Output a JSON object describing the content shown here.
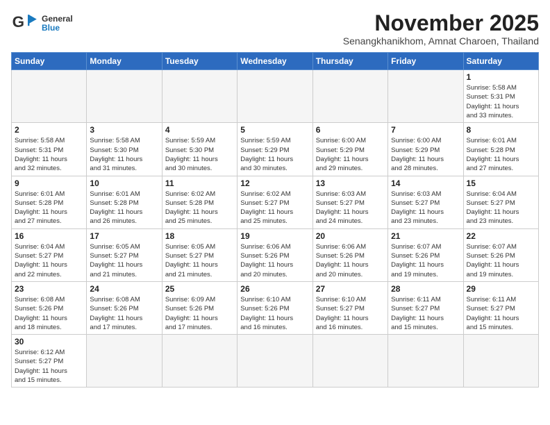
{
  "header": {
    "logo_general": "General",
    "logo_blue": "Blue",
    "month_title": "November 2025",
    "location": "Senangkhanikhom, Amnat Charoen, Thailand"
  },
  "weekdays": [
    "Sunday",
    "Monday",
    "Tuesday",
    "Wednesday",
    "Thursday",
    "Friday",
    "Saturday"
  ],
  "weeks": [
    [
      {
        "day": "",
        "info": ""
      },
      {
        "day": "",
        "info": ""
      },
      {
        "day": "",
        "info": ""
      },
      {
        "day": "",
        "info": ""
      },
      {
        "day": "",
        "info": ""
      },
      {
        "day": "",
        "info": ""
      },
      {
        "day": "1",
        "info": "Sunrise: 5:58 AM\nSunset: 5:31 PM\nDaylight: 11 hours\nand 33 minutes."
      }
    ],
    [
      {
        "day": "2",
        "info": "Sunrise: 5:58 AM\nSunset: 5:31 PM\nDaylight: 11 hours\nand 32 minutes."
      },
      {
        "day": "3",
        "info": "Sunrise: 5:58 AM\nSunset: 5:30 PM\nDaylight: 11 hours\nand 31 minutes."
      },
      {
        "day": "4",
        "info": "Sunrise: 5:59 AM\nSunset: 5:30 PM\nDaylight: 11 hours\nand 30 minutes."
      },
      {
        "day": "5",
        "info": "Sunrise: 5:59 AM\nSunset: 5:29 PM\nDaylight: 11 hours\nand 30 minutes."
      },
      {
        "day": "6",
        "info": "Sunrise: 6:00 AM\nSunset: 5:29 PM\nDaylight: 11 hours\nand 29 minutes."
      },
      {
        "day": "7",
        "info": "Sunrise: 6:00 AM\nSunset: 5:29 PM\nDaylight: 11 hours\nand 28 minutes."
      },
      {
        "day": "8",
        "info": "Sunrise: 6:01 AM\nSunset: 5:28 PM\nDaylight: 11 hours\nand 27 minutes."
      }
    ],
    [
      {
        "day": "9",
        "info": "Sunrise: 6:01 AM\nSunset: 5:28 PM\nDaylight: 11 hours\nand 27 minutes."
      },
      {
        "day": "10",
        "info": "Sunrise: 6:01 AM\nSunset: 5:28 PM\nDaylight: 11 hours\nand 26 minutes."
      },
      {
        "day": "11",
        "info": "Sunrise: 6:02 AM\nSunset: 5:28 PM\nDaylight: 11 hours\nand 25 minutes."
      },
      {
        "day": "12",
        "info": "Sunrise: 6:02 AM\nSunset: 5:27 PM\nDaylight: 11 hours\nand 25 minutes."
      },
      {
        "day": "13",
        "info": "Sunrise: 6:03 AM\nSunset: 5:27 PM\nDaylight: 11 hours\nand 24 minutes."
      },
      {
        "day": "14",
        "info": "Sunrise: 6:03 AM\nSunset: 5:27 PM\nDaylight: 11 hours\nand 23 minutes."
      },
      {
        "day": "15",
        "info": "Sunrise: 6:04 AM\nSunset: 5:27 PM\nDaylight: 11 hours\nand 23 minutes."
      }
    ],
    [
      {
        "day": "16",
        "info": "Sunrise: 6:04 AM\nSunset: 5:27 PM\nDaylight: 11 hours\nand 22 minutes."
      },
      {
        "day": "17",
        "info": "Sunrise: 6:05 AM\nSunset: 5:27 PM\nDaylight: 11 hours\nand 21 minutes."
      },
      {
        "day": "18",
        "info": "Sunrise: 6:05 AM\nSunset: 5:27 PM\nDaylight: 11 hours\nand 21 minutes."
      },
      {
        "day": "19",
        "info": "Sunrise: 6:06 AM\nSunset: 5:26 PM\nDaylight: 11 hours\nand 20 minutes."
      },
      {
        "day": "20",
        "info": "Sunrise: 6:06 AM\nSunset: 5:26 PM\nDaylight: 11 hours\nand 20 minutes."
      },
      {
        "day": "21",
        "info": "Sunrise: 6:07 AM\nSunset: 5:26 PM\nDaylight: 11 hours\nand 19 minutes."
      },
      {
        "day": "22",
        "info": "Sunrise: 6:07 AM\nSunset: 5:26 PM\nDaylight: 11 hours\nand 19 minutes."
      }
    ],
    [
      {
        "day": "23",
        "info": "Sunrise: 6:08 AM\nSunset: 5:26 PM\nDaylight: 11 hours\nand 18 minutes."
      },
      {
        "day": "24",
        "info": "Sunrise: 6:08 AM\nSunset: 5:26 PM\nDaylight: 11 hours\nand 17 minutes."
      },
      {
        "day": "25",
        "info": "Sunrise: 6:09 AM\nSunset: 5:26 PM\nDaylight: 11 hours\nand 17 minutes."
      },
      {
        "day": "26",
        "info": "Sunrise: 6:10 AM\nSunset: 5:26 PM\nDaylight: 11 hours\nand 16 minutes."
      },
      {
        "day": "27",
        "info": "Sunrise: 6:10 AM\nSunset: 5:27 PM\nDaylight: 11 hours\nand 16 minutes."
      },
      {
        "day": "28",
        "info": "Sunrise: 6:11 AM\nSunset: 5:27 PM\nDaylight: 11 hours\nand 15 minutes."
      },
      {
        "day": "29",
        "info": "Sunrise: 6:11 AM\nSunset: 5:27 PM\nDaylight: 11 hours\nand 15 minutes."
      }
    ],
    [
      {
        "day": "30",
        "info": "Sunrise: 6:12 AM\nSunset: 5:27 PM\nDaylight: 11 hours\nand 15 minutes."
      },
      {
        "day": "",
        "info": ""
      },
      {
        "day": "",
        "info": ""
      },
      {
        "day": "",
        "info": ""
      },
      {
        "day": "",
        "info": ""
      },
      {
        "day": "",
        "info": ""
      },
      {
        "day": "",
        "info": ""
      }
    ]
  ]
}
